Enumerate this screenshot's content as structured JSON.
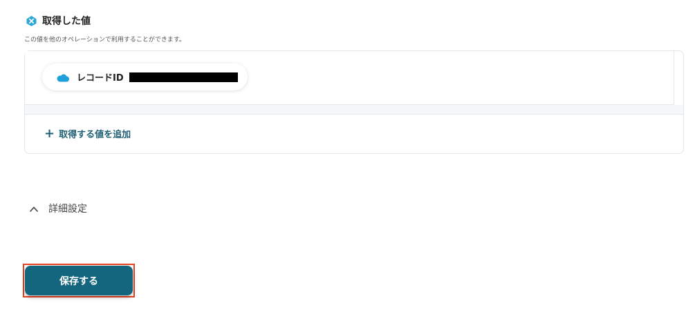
{
  "section": {
    "title": "取得した値",
    "description": "この値を他のオペレーションで利用することができます。",
    "icon": "x-badge-icon",
    "icon_color": "#2aa6d8"
  },
  "values": {
    "items": [
      {
        "icon": "salesforce-cloud-icon",
        "label": "レコードID",
        "value_redacted": true
      }
    ],
    "add_label": "取得する値を追加"
  },
  "advanced": {
    "label": "詳細設定",
    "expanded": true
  },
  "footer": {
    "save_label": "保存する",
    "save_color": "#13667d",
    "highlight_color": "#e8411f"
  }
}
